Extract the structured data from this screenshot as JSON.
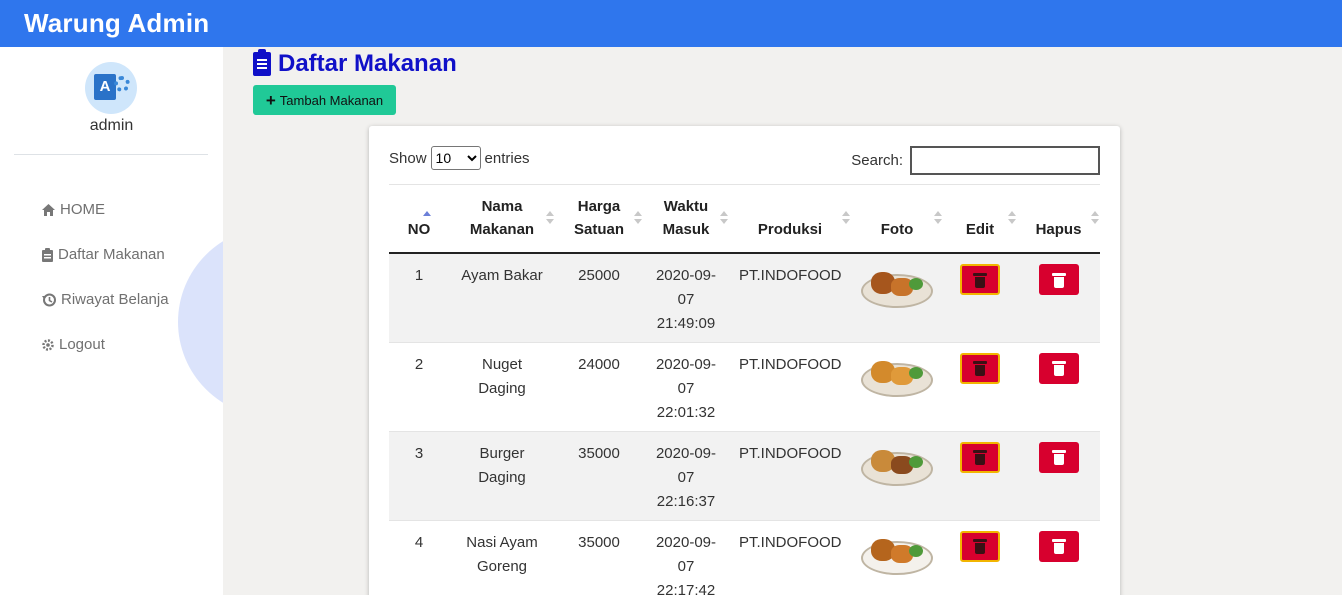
{
  "header": {
    "brand": "Warung Admin"
  },
  "sidebar": {
    "username": "admin",
    "items": [
      {
        "label": "HOME",
        "icon": "home-icon"
      },
      {
        "label": "Daftar Makanan",
        "icon": "clipboard-icon"
      },
      {
        "label": "Riwayat Belanja",
        "icon": "history-icon"
      },
      {
        "label": "Logout",
        "icon": "gear-icon"
      }
    ]
  },
  "main": {
    "title": "Daftar Makanan",
    "add_button": "Tambah Makanan"
  },
  "table_controls": {
    "show_label": "Show",
    "entries_value": "10",
    "entries_label": "entries",
    "search_label": "Search:",
    "search_value": ""
  },
  "table": {
    "columns": [
      {
        "line1": "",
        "line2": "NO"
      },
      {
        "line1": "Nama",
        "line2": "Makanan"
      },
      {
        "line1": "Harga",
        "line2": "Satuan"
      },
      {
        "line1": "Waktu",
        "line2": "Masuk"
      },
      {
        "line1": "",
        "line2": "Produksi"
      },
      {
        "line1": "",
        "line2": "Foto"
      },
      {
        "line1": "",
        "line2": "Edit"
      },
      {
        "line1": "",
        "line2": "Hapus"
      }
    ],
    "rows": [
      {
        "no": "1",
        "nama1": "Ayam Bakar",
        "nama2": "",
        "harga": "25000",
        "waktu1": "2020-09-",
        "waktu2": "07",
        "waktu3": "21:49:09",
        "produksi": "PT.INDOFOOD"
      },
      {
        "no": "2",
        "nama1": "Nuget",
        "nama2": "Daging",
        "harga": "24000",
        "waktu1": "2020-09-",
        "waktu2": "07",
        "waktu3": "22:01:32",
        "produksi": "PT.INDOFOOD"
      },
      {
        "no": "3",
        "nama1": "Burger",
        "nama2": "Daging",
        "harga": "35000",
        "waktu1": "2020-09-",
        "waktu2": "07",
        "waktu3": "22:16:37",
        "produksi": "PT.INDOFOOD"
      },
      {
        "no": "4",
        "nama1": "Nasi Ayam",
        "nama2": "Goreng",
        "harga": "35000",
        "waktu1": "2020-09-",
        "waktu2": "07",
        "waktu3": "22:17:42",
        "produksi": "PT.INDOFOOD"
      }
    ]
  },
  "colors": {
    "topbar": "#2f76ed",
    "title": "#1010c8",
    "add_button": "#20c997",
    "action_button": "#d7002e",
    "edit_border": "#f2b500"
  }
}
